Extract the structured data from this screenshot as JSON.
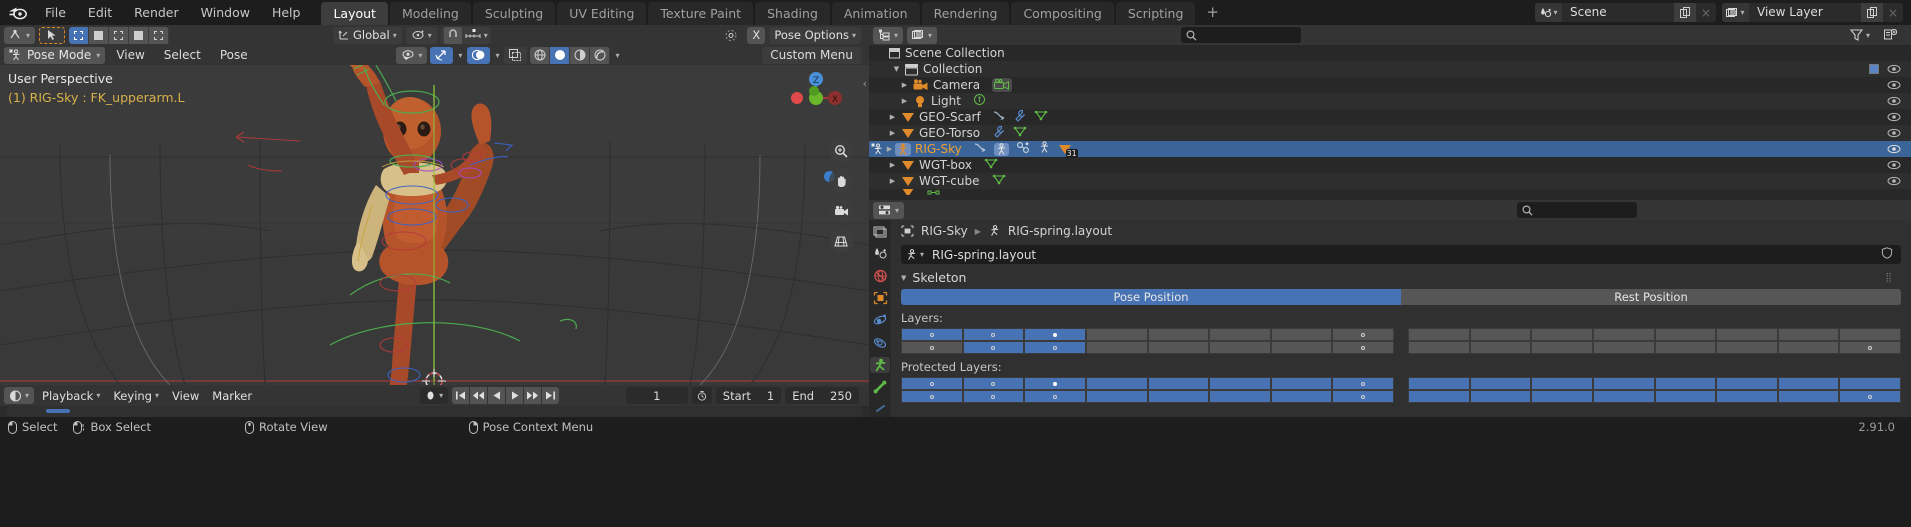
{
  "app": {
    "name": "Blender",
    "version": "2.91.0",
    "logo_icon": "blender-logo-icon"
  },
  "topbar": {
    "menus": [
      "File",
      "Edit",
      "Render",
      "Window",
      "Help"
    ],
    "workspaces": [
      {
        "label": "Layout",
        "active": true
      },
      {
        "label": "Modeling",
        "active": false
      },
      {
        "label": "Sculpting",
        "active": false
      },
      {
        "label": "UV Editing",
        "active": false
      },
      {
        "label": "Texture Paint",
        "active": false
      },
      {
        "label": "Shading",
        "active": false
      },
      {
        "label": "Animation",
        "active": false
      },
      {
        "label": "Rendering",
        "active": false
      },
      {
        "label": "Compositing",
        "active": false
      },
      {
        "label": "Scripting",
        "active": false
      }
    ],
    "add_workspace_label": "+",
    "scene": {
      "icon": "scene-icon",
      "name": "Scene",
      "new_label": "new-scene-icon",
      "remove_label": "×"
    },
    "view_layer": {
      "icon": "view-layer-icon",
      "name": "View Layer",
      "new_label": "new-layer-icon",
      "remove_label": "×"
    }
  },
  "viewport_header": {
    "editor_type_icon": "editor-type-icon",
    "cursor_tool_icon": "tweak-tool-icon",
    "select_modes": [
      "set-select-icon",
      "extend-select-icon",
      "subtract-select-icon",
      "invert-select-icon",
      "intersect-select-icon"
    ],
    "transform_orientation": {
      "icon": "orientation-icon",
      "value": "Global"
    },
    "pivot_point_icon": "pivot-point-icon",
    "snap_magnet_icon": "snap-magnet-icon",
    "snap_target_icon": "snap-increment-icon",
    "proportional_edit_icon": "proportional-edit-icon",
    "proportional_off_label": "X",
    "pose_options_label": "Pose Options"
  },
  "viewport": {
    "mode": "Pose Mode",
    "mode_icon": "pose-mode-icon",
    "menus": [
      "View",
      "Select",
      "Pose"
    ],
    "custom_menu_label": "Custom Menu",
    "overlay_perspective": "User Perspective",
    "overlay_object": "(1) RIG-Sky : FK_upperarm.L",
    "right_icons": [
      {
        "name": "visibility-icon",
        "on": false
      },
      {
        "name": "gizmo-icon",
        "on": true
      },
      {
        "name": "overlays-icon",
        "on": true
      },
      {
        "name": "xray-icon",
        "on": false
      }
    ],
    "shading_modes": [
      {
        "name": "wireframe-shading-icon",
        "on": false
      },
      {
        "name": "solid-shading-icon",
        "on": true
      },
      {
        "name": "material-preview-shading-icon",
        "on": false
      },
      {
        "name": "rendered-shading-icon",
        "on": false
      }
    ],
    "nav_gizmo_axes": [
      "Z",
      "X"
    ],
    "side_buttons": [
      "zoom-icon",
      "pan-hand-icon",
      "camera-view-icon",
      "ortho-persp-icon"
    ]
  },
  "timeline": {
    "editor_icon": "timeline-editor-icon",
    "menus": [
      "Playback",
      "Keying",
      "View",
      "Marker"
    ],
    "keying_set_icon": "keying-set-icon",
    "playback_buttons": [
      "jump-to-start-icon",
      "jump-to-prev-keyframe-icon",
      "play-reverse-icon",
      "play-icon",
      "jump-to-next-keyframe-icon",
      "jump-to-end-icon"
    ],
    "current_frame": "1",
    "auto_keying_icon": "auto-keying-icon",
    "start_label": "Start",
    "start_value": "1",
    "end_label": "End",
    "end_value": "250"
  },
  "statusbar": {
    "items": [
      {
        "icon": "mouse-left-icon",
        "label": "Select"
      },
      {
        "icon": "mouse-left-drag-icon",
        "label": "Box Select"
      },
      {
        "icon": "mouse-middle-icon",
        "label": "Rotate View"
      },
      {
        "icon": "mouse-right-icon",
        "label": "Pose Context Menu"
      }
    ],
    "version": "2.91.0"
  },
  "outliner": {
    "display_mode_icon": "outliner-display-mode-icon",
    "view_layer_icon": "outliner-view-layer-icon",
    "search_placeholder": "",
    "filter_icon": "filter-funnel-icon",
    "new_collection_icon": "new-collection-icon",
    "rows": [
      {
        "label": "Scene Collection",
        "icon": "scene-collection-icon",
        "indent": 0,
        "disclosure": "",
        "selected": false,
        "icons": [],
        "eye": false,
        "checkbox": false
      },
      {
        "label": "Collection",
        "icon": "collection-icon",
        "indent": 1,
        "disclosure": "down",
        "selected": false,
        "icons": [],
        "eye": true,
        "checkbox": true
      },
      {
        "label": "Camera",
        "icon": "camera-object-icon",
        "indent": 2,
        "disclosure": "right",
        "selected": false,
        "icons": [
          "camera-data-icon"
        ],
        "eye": true,
        "checkbox": false
      },
      {
        "label": "Light",
        "icon": "light-object-icon",
        "indent": 2,
        "disclosure": "right",
        "selected": false,
        "icons": [
          "light-data-icon"
        ],
        "eye": true,
        "checkbox": false
      },
      {
        "label": "GEO-Scarf",
        "icon": "mesh-object-icon",
        "indent": 1,
        "disclosure": "right",
        "selected": false,
        "icons": [
          "animation-data-icon",
          "modifier-icon",
          "mesh-data-icon"
        ],
        "eye": true,
        "checkbox": false
      },
      {
        "label": "GEO-Torso",
        "icon": "mesh-object-icon",
        "indent": 1,
        "disclosure": "right",
        "selected": false,
        "icons": [
          "modifier-icon",
          "mesh-data-icon"
        ],
        "eye": true,
        "checkbox": false
      },
      {
        "label": "RIG-Sky",
        "icon": "armature-object-icon",
        "indent": 1,
        "disclosure": "right",
        "selected": true,
        "icons": [
          "animation-data-icon",
          "pose-icon",
          "constraint-icon",
          "armature-data-icon",
          "children-mesh-icon"
        ],
        "badge": "31",
        "eye": true,
        "checkbox": false
      },
      {
        "label": "WGT-box",
        "icon": "mesh-object-icon",
        "indent": 1,
        "disclosure": "right",
        "selected": false,
        "icons": [
          "mesh-data-icon"
        ],
        "eye": true,
        "checkbox": false
      },
      {
        "label": "WGT-cube",
        "icon": "mesh-object-icon",
        "indent": 1,
        "disclosure": "right",
        "selected": false,
        "icons": [
          "mesh-data-icon"
        ],
        "eye": true,
        "checkbox": false
      }
    ]
  },
  "properties": {
    "editor_icon": "properties-editor-icon",
    "search_placeholder": "",
    "tabs": [
      {
        "name": "render-properties-tab",
        "icon": "render-icon",
        "active": false
      },
      {
        "name": "output-properties-tab",
        "icon": "output-printer-icon",
        "active": false
      },
      {
        "name": "view-layer-properties-tab",
        "icon": "view-layer-images-icon",
        "active": false
      },
      {
        "name": "scene-properties-tab",
        "icon": "scene-cone-icon",
        "active": false
      },
      {
        "name": "world-properties-tab",
        "icon": "world-globe-icon",
        "active": false
      },
      {
        "name": "object-properties-tab",
        "icon": "object-square-icon",
        "active": false
      },
      {
        "name": "modifier-properties-tab",
        "icon": "wrench-icon",
        "active": false
      },
      {
        "name": "physics-properties-tab",
        "icon": "physics-orbit-icon",
        "active": false
      },
      {
        "name": "object-constraint-tab",
        "icon": "constraint-icon",
        "active": false
      },
      {
        "name": "object-data-properties-tab",
        "icon": "armature-running-man-icon",
        "active": true
      },
      {
        "name": "bone-properties-tab",
        "icon": "bone-icon",
        "active": false
      }
    ],
    "breadcrumb": [
      {
        "icon": "object-square-icon",
        "label": "RIG-Sky"
      },
      {
        "icon": "armature-data-icon",
        "label": "RIG-spring.layout"
      }
    ],
    "datablock": {
      "icon": "armature-data-icon",
      "name": "RIG-spring.layout",
      "fake_user_icon": "shield-fake-user-icon"
    },
    "skeleton_panel": {
      "title": "Skeleton",
      "position_toggle": [
        {
          "label": "Pose Position",
          "on": true
        },
        {
          "label": "Rest Position",
          "on": false
        }
      ],
      "layers_label": "Layers:",
      "protected_layers_label": "Protected Layers:",
      "layers": {
        "left_top": [
          {
            "on": true,
            "dot": "ring"
          },
          {
            "on": true,
            "dot": "ring"
          },
          {
            "on": true,
            "dot": "filled"
          },
          {
            "on": false,
            "dot": ""
          },
          {
            "on": false,
            "dot": ""
          },
          {
            "on": false,
            "dot": ""
          },
          {
            "on": false,
            "dot": ""
          },
          {
            "on": false,
            "dot": "ring"
          }
        ],
        "left_bottom": [
          {
            "on": false,
            "dot": "ring"
          },
          {
            "on": true,
            "dot": "ring"
          },
          {
            "on": true,
            "dot": "ring"
          },
          {
            "on": false,
            "dot": ""
          },
          {
            "on": false,
            "dot": ""
          },
          {
            "on": false,
            "dot": ""
          },
          {
            "on": false,
            "dot": ""
          },
          {
            "on": false,
            "dot": "ring"
          }
        ],
        "right_top": [
          {
            "on": false,
            "dot": ""
          },
          {
            "on": false,
            "dot": ""
          },
          {
            "on": false,
            "dot": ""
          },
          {
            "on": false,
            "dot": ""
          },
          {
            "on": false,
            "dot": ""
          },
          {
            "on": false,
            "dot": ""
          },
          {
            "on": false,
            "dot": ""
          },
          {
            "on": false,
            "dot": ""
          }
        ],
        "right_bottom": [
          {
            "on": false,
            "dot": ""
          },
          {
            "on": false,
            "dot": ""
          },
          {
            "on": false,
            "dot": ""
          },
          {
            "on": false,
            "dot": ""
          },
          {
            "on": false,
            "dot": ""
          },
          {
            "on": false,
            "dot": ""
          },
          {
            "on": false,
            "dot": ""
          },
          {
            "on": false,
            "dot": "ring"
          }
        ]
      },
      "protected": {
        "left_top": [
          {
            "on": true,
            "dot": "ring"
          },
          {
            "on": true,
            "dot": "ring"
          },
          {
            "on": true,
            "dot": "filled"
          },
          {
            "on": true,
            "dot": ""
          },
          {
            "on": true,
            "dot": ""
          },
          {
            "on": true,
            "dot": ""
          },
          {
            "on": true,
            "dot": ""
          },
          {
            "on": true,
            "dot": "ring"
          }
        ],
        "left_bottom": [
          {
            "on": true,
            "dot": "ring"
          },
          {
            "on": true,
            "dot": "ring"
          },
          {
            "on": true,
            "dot": "ring"
          },
          {
            "on": true,
            "dot": ""
          },
          {
            "on": true,
            "dot": ""
          },
          {
            "on": true,
            "dot": ""
          },
          {
            "on": true,
            "dot": ""
          },
          {
            "on": true,
            "dot": "ring"
          }
        ],
        "right_top": [
          {
            "on": true,
            "dot": ""
          },
          {
            "on": true,
            "dot": ""
          },
          {
            "on": true,
            "dot": ""
          },
          {
            "on": true,
            "dot": ""
          },
          {
            "on": true,
            "dot": ""
          },
          {
            "on": true,
            "dot": ""
          },
          {
            "on": true,
            "dot": ""
          },
          {
            "on": true,
            "dot": ""
          }
        ],
        "right_bottom": [
          {
            "on": true,
            "dot": ""
          },
          {
            "on": true,
            "dot": ""
          },
          {
            "on": true,
            "dot": ""
          },
          {
            "on": true,
            "dot": ""
          },
          {
            "on": true,
            "dot": ""
          },
          {
            "on": true,
            "dot": ""
          },
          {
            "on": true,
            "dot": ""
          },
          {
            "on": true,
            "dot": "ring"
          }
        ]
      }
    }
  },
  "colors": {
    "accent_blue": "#4772b3",
    "selected_row": "#3b6498",
    "selected_text": "#f0a030",
    "header_bg": "#343434",
    "editor_bg": "#303030",
    "outliner_bg": "#282828",
    "viewport_bg": "#3b3b3b",
    "character_orange": "#b5542a",
    "scarf_tan": "#d8c08a"
  }
}
